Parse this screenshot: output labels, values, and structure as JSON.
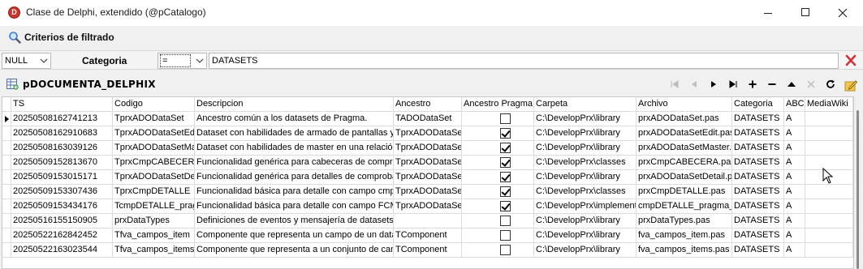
{
  "window": {
    "title": "Clase de Delphi, extendido (@pCatalogo)",
    "app_icon_letter": "D"
  },
  "filter": {
    "heading": "Criterios de filtrado",
    "null_option": "NULL",
    "field_label": "Categoria",
    "operator": "=",
    "value": "DATASETS"
  },
  "grid": {
    "title": "pDOCUMENTA_DELPHIX",
    "columns": [
      "TS",
      "Codigo",
      "Descripcion",
      "Ancestro",
      "Ancestro Pragma",
      "Carpeta",
      "Archivo",
      "Categoria",
      "ABC",
      "MediaWiki"
    ],
    "rows": [
      {
        "ts": "20250508162741213",
        "codigo": "TprxADODataSet",
        "descripcion": "Ancestro común a los datasets de Pragma.",
        "ancestro": "TADODataSet",
        "pragma": false,
        "carpeta": "C:\\DevelopPrx\\library",
        "archivo": "prxADODataSet.pas",
        "categoria": "DATASETS",
        "abc": "A",
        "mediawiki": ""
      },
      {
        "ts": "20250508162910683",
        "codigo": "TprxADODataSetEdit",
        "descripcion": "Dataset con habilidades de armado de pantallas y de",
        "ancestro": "TprxADODataSet",
        "pragma": true,
        "carpeta": "C:\\DevelopPrx\\library",
        "archivo": "prxADODataSetEdit.pas",
        "categoria": "DATASETS",
        "abc": "A",
        "mediawiki": ""
      },
      {
        "ts": "20250508163039126",
        "codigo": "TprxADODataSetMaster",
        "descripcion": "Dataset con habilidades de master en una relación",
        "ancestro": "TprxADODataSet",
        "pragma": true,
        "carpeta": "C:\\DevelopPrx\\library",
        "archivo": "prxADODataSetMaster.pas",
        "categoria": "DATASETS",
        "abc": "A",
        "mediawiki": ""
      },
      {
        "ts": "20250509152813670",
        "codigo": "TprxCmpCABECERA",
        "descripcion": "Funcionalidad genérica para cabeceras de comprobantes",
        "ancestro": "TprxADODataSet",
        "pragma": true,
        "carpeta": "C:\\DevelopPrx\\classes",
        "archivo": "prxCmpCABECERA.pas",
        "categoria": "DATASETS",
        "abc": "A",
        "mediawiki": ""
      },
      {
        "ts": "20250509153015171",
        "codigo": "TprxADODataSetDetail",
        "descripcion": "Funcionalidad genérica para detalles de comprobantes",
        "ancestro": "TprxADODataSet",
        "pragma": true,
        "carpeta": "C:\\DevelopPrx\\library",
        "archivo": "prxADODataSetDetail.pas",
        "categoria": "DATASETS",
        "abc": "A",
        "mediawiki": ""
      },
      {
        "ts": "20250509153307436",
        "codigo": "TprxCmpDETALLE",
        "descripcion": "Funcionalidad básica para detalle con campo cmpLinea",
        "ancestro": "TprxADODataSet",
        "pragma": true,
        "carpeta": "C:\\DevelopPrx\\classes",
        "archivo": "prxCmpDETALLE.pas",
        "categoria": "DATASETS",
        "abc": "A",
        "mediawiki": ""
      },
      {
        "ts": "20250509153434176",
        "codigo": "TcmpDETALLE_pragma",
        "descripcion": "Funcionalidad básica para detalle con campo FCMP",
        "ancestro": "TprxADODataSet",
        "pragma": true,
        "carpeta": "C:\\DevelopPrx\\implement",
        "archivo": "cmpDETALLE_pragma_X",
        "categoria": "DATASETS",
        "abc": "A",
        "mediawiki": ""
      },
      {
        "ts": "20250516155150905",
        "codigo": "prxDataTypes",
        "descripcion": "Definiciones de eventos y mensajería de datasets",
        "ancestro": "",
        "pragma": false,
        "carpeta": "C:\\DevelopPrx\\library",
        "archivo": "prxDataTypes.pas",
        "categoria": "DATASETS",
        "abc": "A",
        "mediawiki": ""
      },
      {
        "ts": "20250522162842452",
        "codigo": "Tfva_campos_item",
        "descripcion": "Componente que representa un campo de un data",
        "ancestro": "TComponent",
        "pragma": false,
        "carpeta": "C:\\DevelopPrx\\library",
        "archivo": "fva_campos_item.pas",
        "categoria": "DATASETS",
        "abc": "A",
        "mediawiki": ""
      },
      {
        "ts": "20250522163023544",
        "codigo": "Tfva_campos_items",
        "descripcion": "Componente que representa a un conjunto de campos",
        "ancestro": "TComponent",
        "pragma": false,
        "carpeta": "C:\\DevelopPrx\\library",
        "archivo": "fva_campos_items.pas",
        "categoria": "DATASETS",
        "abc": "A",
        "mediawiki": ""
      }
    ]
  },
  "toolbar_icons": [
    "first-icon",
    "prior-icon",
    "next-icon",
    "last-icon",
    "insert-icon",
    "delete-icon",
    "edit-icon",
    "cancel-icon",
    "refresh-icon",
    "filter-edit-icon"
  ],
  "colors": {
    "accent_red": "#d13438",
    "title_bar": "#ffffff",
    "window_bg": "#f0f0f0"
  }
}
